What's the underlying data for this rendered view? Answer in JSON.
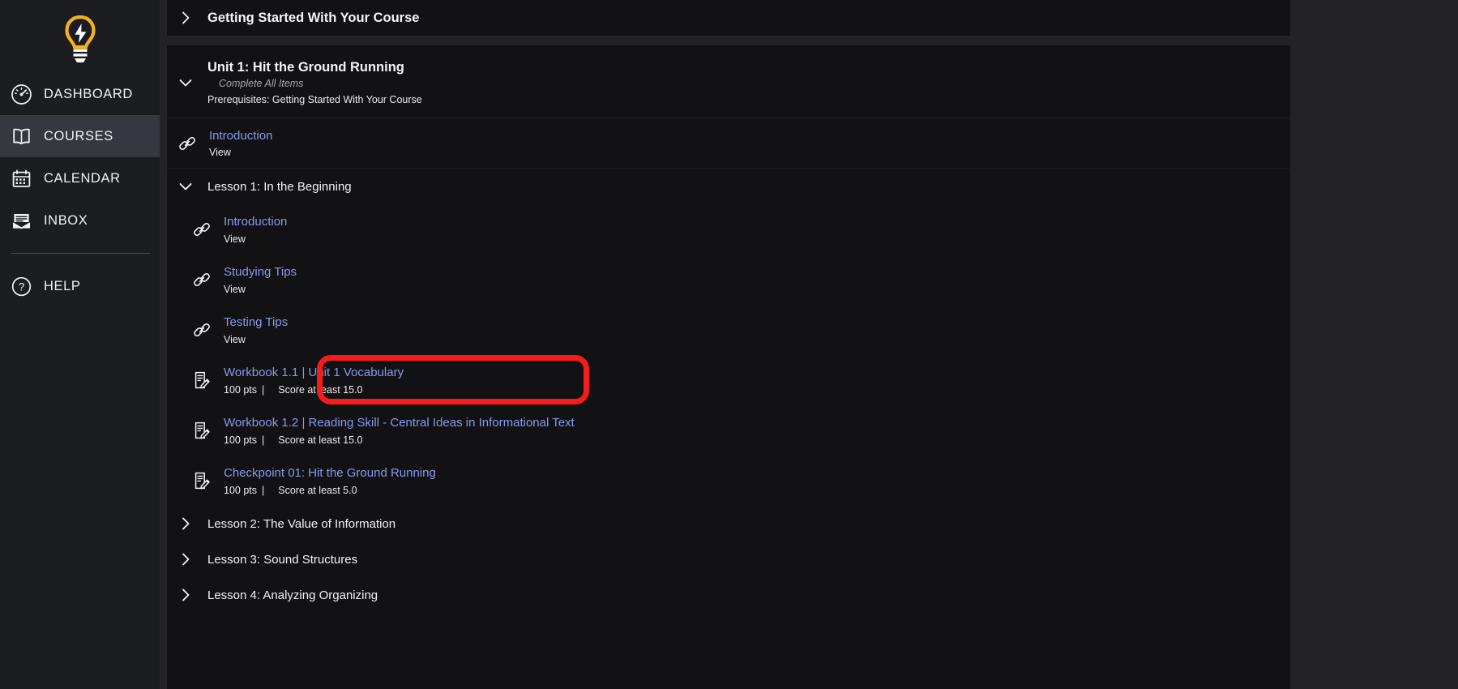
{
  "sidebar": {
    "brand_icon": "lightbulb-logo",
    "items": [
      {
        "id": "dashboard",
        "label": "DASHBOARD",
        "icon": "gauge-icon",
        "active": false
      },
      {
        "id": "courses",
        "label": "COURSES",
        "icon": "book-icon",
        "active": true
      },
      {
        "id": "calendar",
        "label": "CALENDAR",
        "icon": "calendar-icon",
        "active": false
      },
      {
        "id": "inbox",
        "label": "INBOX",
        "icon": "envelope-icon",
        "active": false
      }
    ],
    "help": {
      "id": "help",
      "label": "HELP",
      "icon": "question-circle-icon"
    }
  },
  "main": {
    "module_top": {
      "title": "Getting Started With Your Course",
      "chevron": "chevron-right-icon",
      "expanded": false
    },
    "unit": {
      "title": "Unit 1: Hit the Ground Running",
      "subtitle": "Complete All Items",
      "prerequisites": "Prerequisites: Getting Started With Your Course",
      "chevron": "chevron-down-icon",
      "expanded": true
    },
    "top_item": {
      "icon": "link-icon",
      "title": "Introduction",
      "meta": "View"
    },
    "lesson1": {
      "label": "Lesson 1: In the Beginning",
      "chevron": "chevron-down-icon",
      "expanded": true,
      "items": [
        {
          "icon": "link-icon",
          "title": "Introduction",
          "meta": "View"
        },
        {
          "icon": "link-icon",
          "title": "Studying Tips",
          "meta": "View"
        },
        {
          "icon": "link-icon",
          "title": "Testing Tips",
          "meta": "View"
        },
        {
          "icon": "assignment-icon",
          "title": "Workbook 1.1 | Unit 1 Vocabulary",
          "points": "100 pts",
          "divider": "|",
          "requirement": "Score at least 15.0",
          "highlighted": true
        },
        {
          "icon": "assignment-icon",
          "title": "Workbook 1.2 | Reading Skill - Central Ideas in Informational Text",
          "points": "100 pts",
          "divider": "|",
          "requirement": "Score at least 15.0",
          "highlighted": false
        },
        {
          "icon": "assignment-icon",
          "title": "Checkpoint 01: Hit the Ground Running",
          "points": "100 pts",
          "divider": "|",
          "requirement": "Score at least 5.0",
          "highlighted": false
        }
      ]
    },
    "other_lessons": [
      {
        "label": "Lesson 2: The Value of Information",
        "chevron": "chevron-right-icon"
      },
      {
        "label": "Lesson 3: Sound Structures",
        "chevron": "chevron-right-icon"
      },
      {
        "label": "Lesson 4: Analyzing Organizing",
        "chevron": "chevron-right-icon"
      }
    ]
  },
  "colors": {
    "page_background": "#232326",
    "sidebar_background": "#1c1d21",
    "sidebar_active": "#35383f",
    "card_background": "#121214",
    "link": "#8899ee",
    "brand_yellow": "#f5b21c",
    "highlight_red": "#f71b1b",
    "text_primary": "#f2f2f2",
    "text_muted": "#a7a9ad"
  }
}
